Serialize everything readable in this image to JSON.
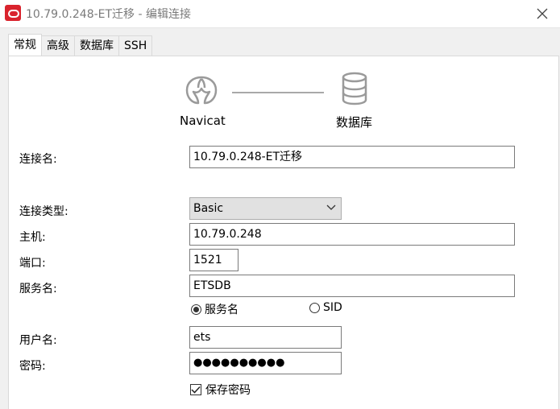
{
  "window": {
    "title": "10.79.0.248-ET迁移 - 编辑连接",
    "app_icon": "navicat-app-icon",
    "close_icon": "close-icon"
  },
  "tabs": [
    {
      "label": "常规",
      "active": true
    },
    {
      "label": "高级",
      "active": false
    },
    {
      "label": "数据库",
      "active": false
    },
    {
      "label": "SSH",
      "active": false
    }
  ],
  "diagram": {
    "left_label": "Navicat",
    "right_label": "数据库",
    "left_icon": "navicat-logo-icon",
    "right_icon": "database-icon"
  },
  "form": {
    "connection_name_label": "连接名:",
    "connection_name_value": "10.79.0.248-ET迁移",
    "connection_type_label": "连接类型:",
    "connection_type_value": "Basic",
    "host_label": "主机:",
    "host_value": "10.79.0.248",
    "port_label": "端口:",
    "port_value": "1521",
    "service_name_label": "服务名:",
    "service_name_value": "ETSDB",
    "radio_service_name": "服务名",
    "radio_sid": "SID",
    "selected_radio": "服务名",
    "username_label": "用户名:",
    "username_value": "ets",
    "password_label": "密码:",
    "password_value": "●●●●●●●●●●",
    "save_password_label": "保存密码",
    "save_password_checked": true
  }
}
